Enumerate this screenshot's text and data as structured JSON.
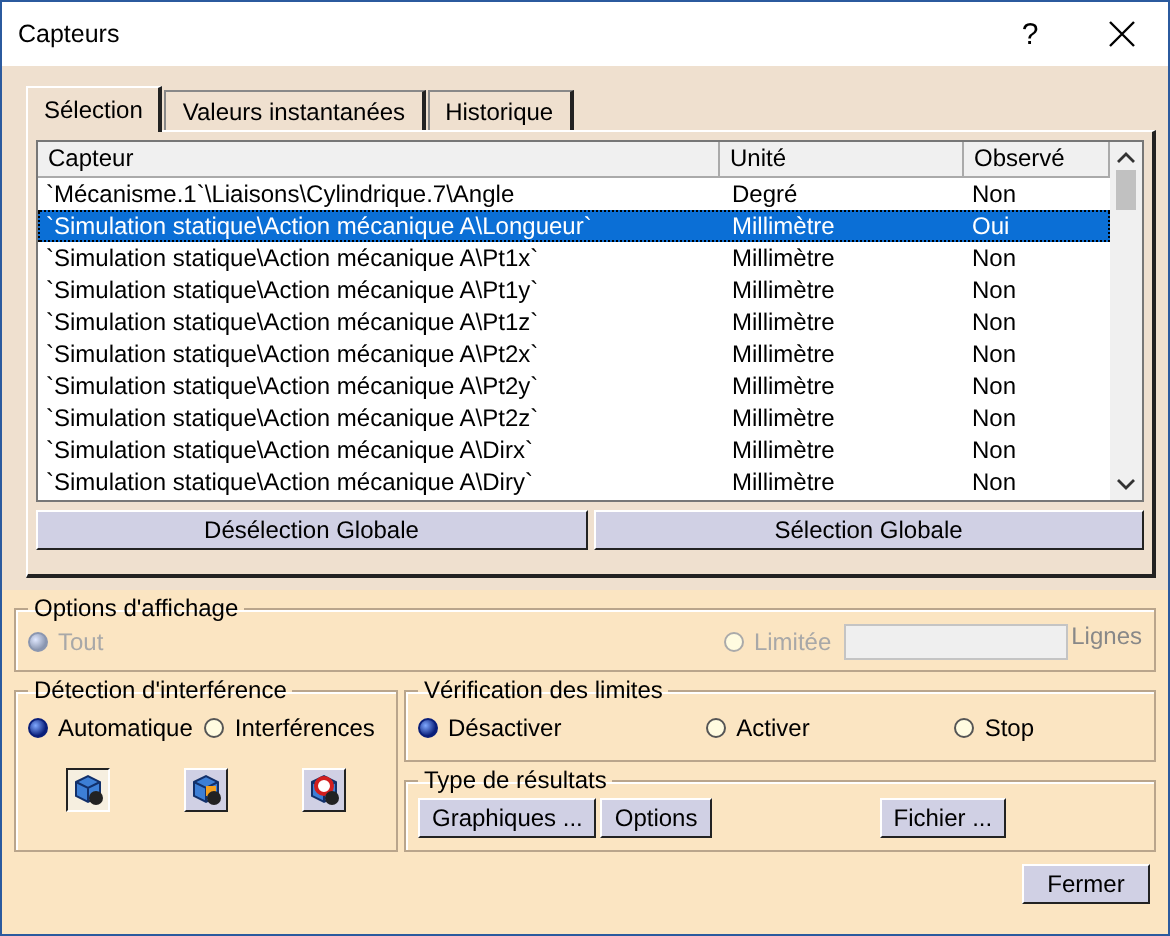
{
  "window": {
    "title": "Capteurs",
    "help": "?"
  },
  "tabs": [
    {
      "label": "Sélection",
      "selected": true
    },
    {
      "label": "Valeurs instantanées",
      "selected": false
    },
    {
      "label": "Historique",
      "selected": false
    }
  ],
  "table": {
    "columns": [
      "Capteur",
      "Unité",
      "Observé"
    ],
    "rows": [
      {
        "cells": [
          "`Mécanisme.1`\\Liaisons\\Cylindrique.7\\Angle",
          "Degré",
          "Non"
        ],
        "selected": false
      },
      {
        "cells": [
          "`Simulation statique\\Action mécanique A\\Longueur`",
          "Millimètre",
          "Oui"
        ],
        "selected": true
      },
      {
        "cells": [
          "`Simulation statique\\Action mécanique A\\Pt1x`",
          "Millimètre",
          "Non"
        ],
        "selected": false
      },
      {
        "cells": [
          "`Simulation statique\\Action mécanique A\\Pt1y`",
          "Millimètre",
          "Non"
        ],
        "selected": false
      },
      {
        "cells": [
          "`Simulation statique\\Action mécanique A\\Pt1z`",
          "Millimètre",
          "Non"
        ],
        "selected": false
      },
      {
        "cells": [
          "`Simulation statique\\Action mécanique A\\Pt2x`",
          "Millimètre",
          "Non"
        ],
        "selected": false
      },
      {
        "cells": [
          "`Simulation statique\\Action mécanique A\\Pt2y`",
          "Millimètre",
          "Non"
        ],
        "selected": false
      },
      {
        "cells": [
          "`Simulation statique\\Action mécanique A\\Pt2z`",
          "Millimètre",
          "Non"
        ],
        "selected": false
      },
      {
        "cells": [
          "`Simulation statique\\Action mécanique A\\Dirx`",
          "Millimètre",
          "Non"
        ],
        "selected": false
      },
      {
        "cells": [
          "`Simulation statique\\Action mécanique A\\Diry`",
          "Millimètre",
          "Non"
        ],
        "selected": false
      }
    ]
  },
  "table_buttons": [
    "Désélection Globale",
    "Sélection Globale"
  ],
  "display_options": {
    "title": "Options d'affichage",
    "all": {
      "label": "Tout",
      "selected": true,
      "disabled": true
    },
    "limited": {
      "label": "Limitée",
      "selected": false,
      "disabled": true
    },
    "lines_field": {
      "disabled": true
    },
    "lines_label": "Lignes"
  },
  "interference": {
    "title": "Détection d'interférence",
    "options": [
      {
        "label": "Automatique",
        "selected": true
      },
      {
        "label": "Interférences",
        "selected": false
      }
    ],
    "icon_buttons": [
      {
        "selected": true
      },
      {
        "selected": false
      },
      {
        "selected": false
      }
    ]
  },
  "limits": {
    "title": "Vérification des limites",
    "options": [
      {
        "label": "Désactiver",
        "selected": true
      },
      {
        "label": "Activer",
        "selected": false
      },
      {
        "label": "Stop",
        "selected": false
      }
    ]
  },
  "results": {
    "title": "Type de résultats",
    "buttons": [
      "Graphiques ...",
      "Options",
      "Fichier ..."
    ]
  },
  "close_button": "Fermer"
}
